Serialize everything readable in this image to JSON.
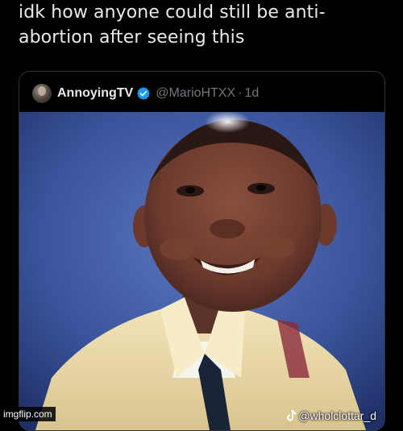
{
  "post": {
    "caption": "idk how anyone could still be anti-abortion after seeing this"
  },
  "quoted_tweet": {
    "display_name": "AnnoyingTV",
    "handle": "@MarioHTXX",
    "separator": "·",
    "time": "1d",
    "verified": true,
    "avatar_icon": "avatar-photo",
    "verified_icon": "verified-badge-icon",
    "verified_color": "#1d9bf0"
  },
  "overlay": {
    "tiktok_handle": "@wholclottar_d",
    "tiktok_icon": "tiktok-icon",
    "watermark": "imgflip.com"
  },
  "colors": {
    "background": "#000000",
    "text_primary": "#e7e9ea",
    "text_secondary": "#71767b",
    "card_border": "#2f3336"
  }
}
